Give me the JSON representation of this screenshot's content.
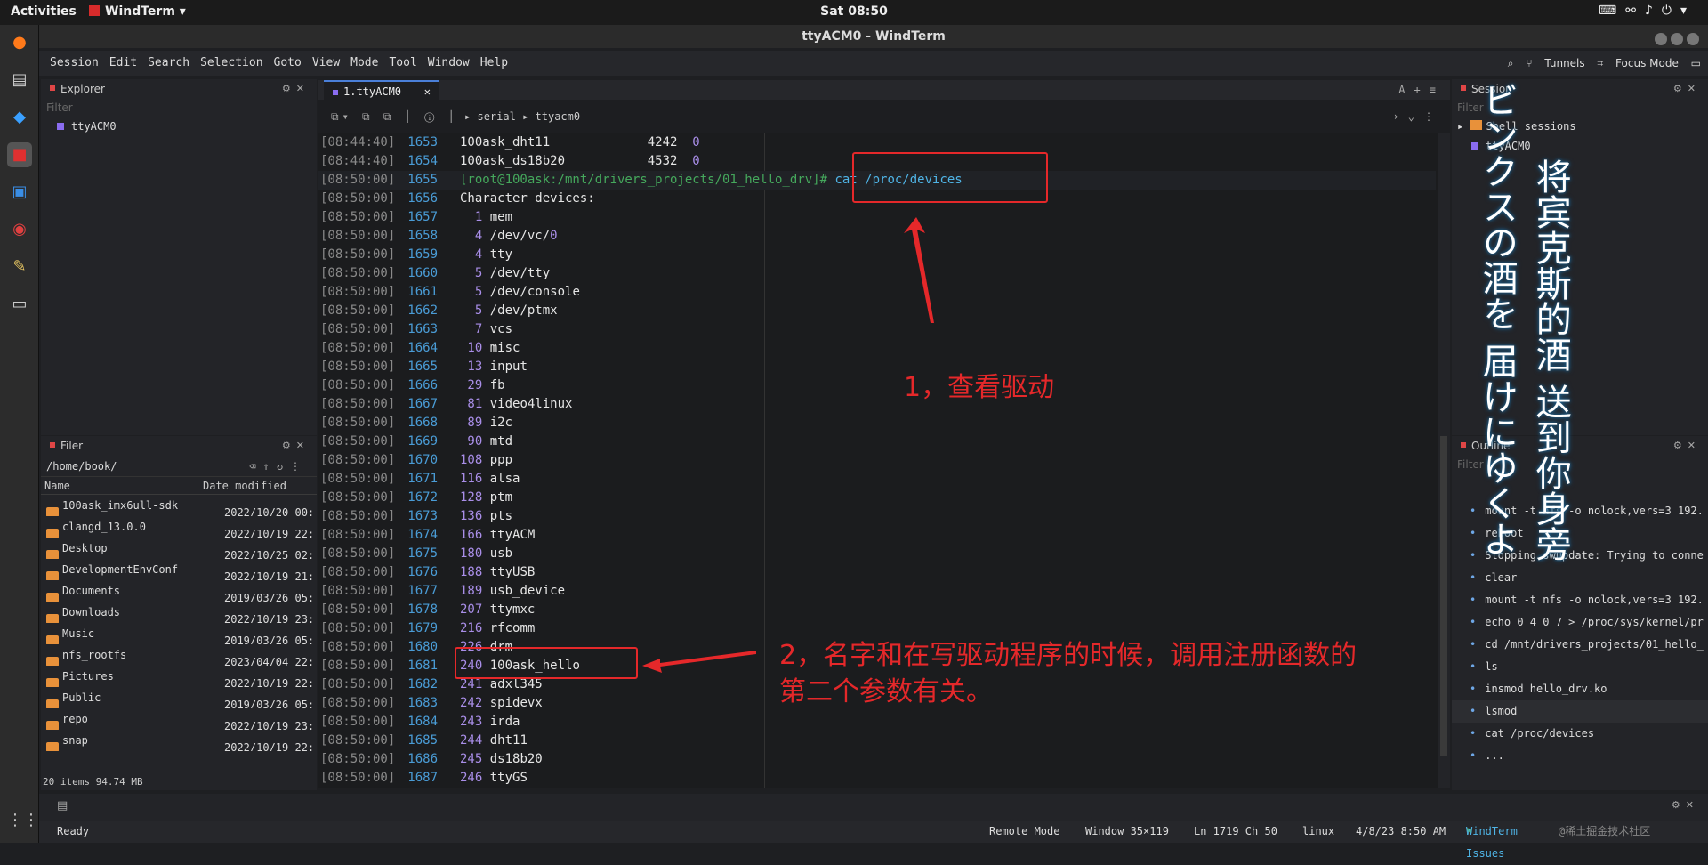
{
  "topbar": {
    "activities": "Activities",
    "app": "WindTerm",
    "clock": "Sat 08:50"
  },
  "window": {
    "title": "ttyACM0 - WindTerm"
  },
  "menu": [
    "Session",
    "Edit",
    "Search",
    "Selection",
    "Goto",
    "View",
    "Mode",
    "Tool",
    "Window",
    "Help"
  ],
  "menu_right": {
    "tunnels": "Tunnels",
    "focus": "Focus Mode"
  },
  "explorer": {
    "title": "Explorer",
    "filter_placeholder": "Filter",
    "items": [
      "ttyACM0"
    ]
  },
  "filer": {
    "title": "Filer",
    "path": "/home/book/",
    "col_name": "Name",
    "col_date": "Date modified",
    "rows": [
      {
        "name": "100ask_imx6ull-sdk",
        "date": "2022/10/20 00:.."
      },
      {
        "name": "clangd_13.0.0",
        "date": "2022/10/19 22:.."
      },
      {
        "name": "Desktop",
        "date": "2022/10/25 02:.."
      },
      {
        "name": "DevelopmentEnvConf",
        "date": "2022/10/19 21:.."
      },
      {
        "name": "Documents",
        "date": "2019/03/26 05:.."
      },
      {
        "name": "Downloads",
        "date": "2022/10/19 23:.."
      },
      {
        "name": "Music",
        "date": "2019/03/26 05:.."
      },
      {
        "name": "nfs_rootfs",
        "date": "2023/04/04 22:.."
      },
      {
        "name": "Pictures",
        "date": "2022/10/19 22:.."
      },
      {
        "name": "Public",
        "date": "2019/03/26 05:.."
      },
      {
        "name": "repo",
        "date": "2022/10/19 23:.."
      },
      {
        "name": "snap",
        "date": "2022/10/19 22:.."
      }
    ],
    "status": "20 items 94.74 MB"
  },
  "tab": {
    "label": "1.ttyACM0",
    "close": "✕"
  },
  "address": {
    "protocol": "serial",
    "target": "ttyacm0"
  },
  "terminal": [
    {
      "ts": "[08:44:40]",
      "ln": "1653",
      "a": "100ask_dht11             4242  ",
      "n": "0"
    },
    {
      "ts": "[08:44:40]",
      "ln": "1654",
      "a": "100ask_ds18b20           4532  ",
      "n": "0"
    },
    {
      "ts": "[08:50:00]",
      "ln": "1655",
      "prompt": "[root@100ask:/mnt/drivers_projects/01_hello_drv]# ",
      "cmd": "cat /proc/devices"
    },
    {
      "ts": "[08:50:00]",
      "ln": "1656",
      "a": "Character devices:"
    },
    {
      "ts": "[08:50:00]",
      "ln": "1657",
      "num": "  1",
      "a": " mem"
    },
    {
      "ts": "[08:50:00]",
      "ln": "1658",
      "num": "  4",
      "a": " /dev/vc/",
      "n": "0"
    },
    {
      "ts": "[08:50:00]",
      "ln": "1659",
      "num": "  4",
      "a": " tty"
    },
    {
      "ts": "[08:50:00]",
      "ln": "1660",
      "num": "  5",
      "a": " /dev/tty"
    },
    {
      "ts": "[08:50:00]",
      "ln": "1661",
      "num": "  5",
      "a": " /dev/console"
    },
    {
      "ts": "[08:50:00]",
      "ln": "1662",
      "num": "  5",
      "a": " /dev/ptmx"
    },
    {
      "ts": "[08:50:00]",
      "ln": "1663",
      "num": "  7",
      "a": " vcs"
    },
    {
      "ts": "[08:50:00]",
      "ln": "1664",
      "num": " 10",
      "a": " misc"
    },
    {
      "ts": "[08:50:00]",
      "ln": "1665",
      "num": " 13",
      "a": " input"
    },
    {
      "ts": "[08:50:00]",
      "ln": "1666",
      "num": " 29",
      "a": " fb"
    },
    {
      "ts": "[08:50:00]",
      "ln": "1667",
      "num": " 81",
      "a": " video4linux"
    },
    {
      "ts": "[08:50:00]",
      "ln": "1668",
      "num": " 89",
      "a": " i2c"
    },
    {
      "ts": "[08:50:00]",
      "ln": "1669",
      "num": " 90",
      "a": " mtd"
    },
    {
      "ts": "[08:50:00]",
      "ln": "1670",
      "num": "108",
      "a": " ppp"
    },
    {
      "ts": "[08:50:00]",
      "ln": "1671",
      "num": "116",
      "a": " alsa"
    },
    {
      "ts": "[08:50:00]",
      "ln": "1672",
      "num": "128",
      "a": " ptm"
    },
    {
      "ts": "[08:50:00]",
      "ln": "1673",
      "num": "136",
      "a": " pts"
    },
    {
      "ts": "[08:50:00]",
      "ln": "1674",
      "num": "166",
      "a": " ttyACM"
    },
    {
      "ts": "[08:50:00]",
      "ln": "1675",
      "num": "180",
      "a": " usb"
    },
    {
      "ts": "[08:50:00]",
      "ln": "1676",
      "num": "188",
      "a": " ttyUSB"
    },
    {
      "ts": "[08:50:00]",
      "ln": "1677",
      "num": "189",
      "a": " usb_device"
    },
    {
      "ts": "[08:50:00]",
      "ln": "1678",
      "num": "207",
      "a": " ttymxc"
    },
    {
      "ts": "[08:50:00]",
      "ln": "1679",
      "num": "216",
      "a": " rfcomm"
    },
    {
      "ts": "[08:50:00]",
      "ln": "1680",
      "num": "226",
      "a": " drm"
    },
    {
      "ts": "[08:50:00]",
      "ln": "1681",
      "num": "240",
      "a": " 100ask_hello"
    },
    {
      "ts": "[08:50:00]",
      "ln": "1682",
      "num": "241",
      "a": " adxl345"
    },
    {
      "ts": "[08:50:00]",
      "ln": "1683",
      "num": "242",
      "a": " spidevx"
    },
    {
      "ts": "[08:50:00]",
      "ln": "1684",
      "num": "243",
      "a": " irda"
    },
    {
      "ts": "[08:50:00]",
      "ln": "1685",
      "num": "244",
      "a": " dht11"
    },
    {
      "ts": "[08:50:00]",
      "ln": "1686",
      "num": "245",
      "a": " ds18b20"
    },
    {
      "ts": "[08:50:00]",
      "ln": "1687",
      "num": "246",
      "a": " ttyGS"
    }
  ],
  "annotations": {
    "a1": "1，查看驱动",
    "a2_line1": "2，名字和在写驱动程序的时候，调用注册函数的",
    "a2_line2": "第二个参数有关。"
  },
  "session": {
    "title": "Session",
    "filter_placeholder": "Filter",
    "shell": "Shell sessions",
    "item": "ttyACM0"
  },
  "outline": {
    "title": "Outline",
    "filter_placeholder": "Filter",
    "items": [
      "mount -t nfs -o nolock,vers=3 192.",
      "reboot",
      "Stopping swupdate: Trying to conne",
      "clear",
      "mount -t nfs -o nolock,vers=3 192.",
      "echo 0 4 0 7 > /proc/sys/kernel/pr",
      "cd /mnt/drivers_projects/01_hello_",
      "ls",
      "insmod hello_drv.ko",
      "lsmod",
      "cat /proc/devices",
      "..."
    ]
  },
  "lyrics": {
    "col1": "将宾克斯的酒 送到你身旁",
    "col2": "ビンクスの酒を 届けにゆくよ"
  },
  "statusbar": {
    "ready": "Ready",
    "mode": "Remote Mode",
    "window": "Window 35×119",
    "pos": "Ln 1719 Ch 50",
    "os": "linux",
    "time": "4/8/23 8:50 AM",
    "issues": "WindTerm Issues",
    "watermark": "@稀土掘金技术社区"
  }
}
